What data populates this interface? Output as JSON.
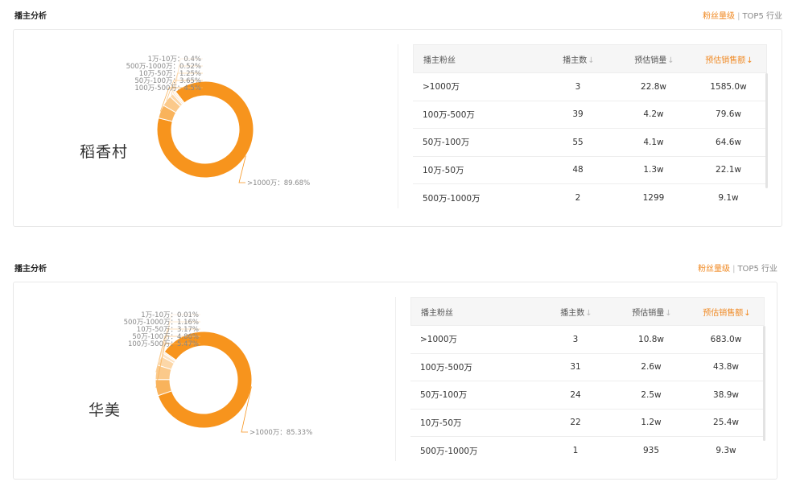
{
  "sections": [
    {
      "title": "播主分析",
      "link_active": "粉丝量级",
      "link_sep": "|",
      "link_normal": "TOP5 行业",
      "brand": "稻香村",
      "chart_data": {
        "type": "donut",
        "slices": [
          {
            "label": ">1000万",
            "value": 89.68,
            "text": ">1000万：89.68%",
            "color": "#f7941d"
          },
          {
            "label": "100万-500万",
            "value": 4.5,
            "text": "100万-500万：4.5%",
            "color": "#f9b35c"
          },
          {
            "label": "50万-100万",
            "value": 3.65,
            "text": "50万-100万：3.65%",
            "color": "#fbc98a"
          },
          {
            "label": "10万-50万",
            "value": 1.25,
            "text": "10万-50万：1.25%",
            "color": "#fcd7a8"
          },
          {
            "label": "500万-1000万",
            "value": 0.52,
            "text": "500万-1000万：0.52%",
            "color": "#fde3c4"
          },
          {
            "label": "1万-10万",
            "value": 0.4,
            "text": "1万-10万：0.4%",
            "color": "#feeedb"
          }
        ]
      },
      "table": {
        "headers": [
          "播主粉丝",
          "播主数",
          "预估销量",
          "预估销售额"
        ],
        "sort_arrow": "↓",
        "rows": [
          [
            ">1000万",
            "3",
            "22.8w",
            "1585.0w"
          ],
          [
            "100万-500万",
            "39",
            "4.2w",
            "79.6w"
          ],
          [
            "50万-100万",
            "55",
            "4.1w",
            "64.6w"
          ],
          [
            "10万-50万",
            "48",
            "1.3w",
            "22.1w"
          ],
          [
            "500万-1000万",
            "2",
            "1299",
            "9.1w"
          ]
        ]
      }
    },
    {
      "title": "播主分析",
      "link_active": "粉丝量级",
      "link_sep": "|",
      "link_normal": "TOP5 行业",
      "brand": "华美",
      "chart_data": {
        "type": "donut",
        "slices": [
          {
            "label": ">1000万",
            "value": 85.33,
            "text": ">1000万：85.33%",
            "color": "#f7941d"
          },
          {
            "label": "100万-500万",
            "value": 5.47,
            "text": "100万-500万：5.47%",
            "color": "#f9b35c"
          },
          {
            "label": "50万-100万",
            "value": 4.86,
            "text": "50万-100万：4.86%",
            "color": "#fbc98a"
          },
          {
            "label": "10万-50万",
            "value": 3.17,
            "text": "10万-50万：3.17%",
            "color": "#fcd7a8"
          },
          {
            "label": "500万-1000万",
            "value": 1.16,
            "text": "500万-1000万：1.16%",
            "color": "#fde3c4"
          },
          {
            "label": "1万-10万",
            "value": 0.01,
            "text": "1万-10万：0.01%",
            "color": "#feeedb"
          }
        ]
      },
      "table": {
        "headers": [
          "播主粉丝",
          "播主数",
          "预估销量",
          "预估销售额"
        ],
        "sort_arrow": "↓",
        "rows": [
          [
            ">1000万",
            "3",
            "10.8w",
            "683.0w"
          ],
          [
            "100万-500万",
            "31",
            "2.6w",
            "43.8w"
          ],
          [
            "50万-100万",
            "24",
            "2.5w",
            "38.9w"
          ],
          [
            "10万-50万",
            "22",
            "1.2w",
            "25.4w"
          ],
          [
            "500万-1000万",
            "1",
            "935",
            "9.3w"
          ]
        ]
      }
    }
  ]
}
